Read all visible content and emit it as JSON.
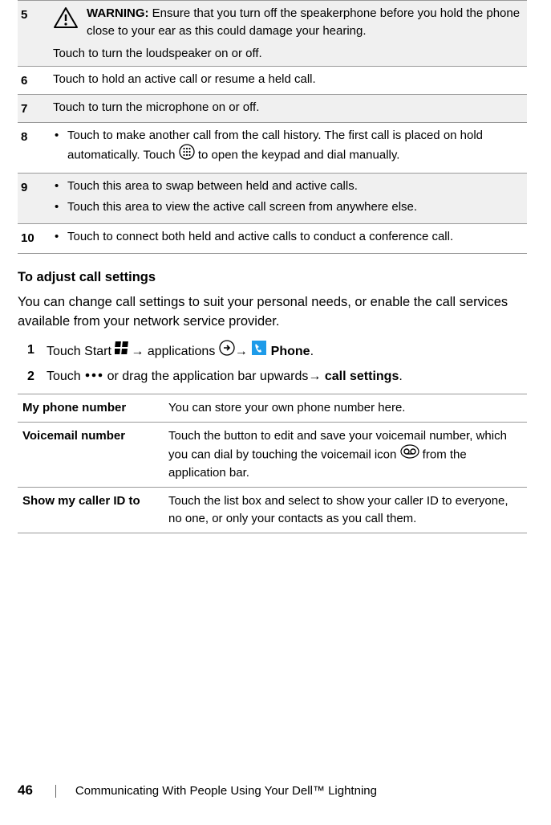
{
  "rows": {
    "r5": {
      "num": "5",
      "warn_label": "WARNING:",
      "warn_text": " Ensure that you turn off the speakerphone before you hold the phone close to your ear as this could damage your hearing.",
      "sub": "Touch to turn the loudspeaker on or off."
    },
    "r6": {
      "num": "6",
      "text": "Touch to hold an active call or resume a held call."
    },
    "r7": {
      "num": "7",
      "text": "Touch to turn the microphone on or off."
    },
    "r8": {
      "num": "8",
      "pre": "Touch to make another call from the call history. The first call is placed on hold automatically. Touch ",
      "post": " to open the keypad and dial manually."
    },
    "r9": {
      "num": "9",
      "b1": "Touch this area to swap between held and active calls.",
      "b2": "Touch this area to view the active call screen from anywhere else."
    },
    "r10": {
      "num": "10",
      "text": "Touch to connect both held and active calls to conduct a conference call."
    }
  },
  "heading": "To adjust call settings",
  "para": "You can change call settings to suit your personal needs, or enable the call services available from your network service provider.",
  "steps": {
    "s1": {
      "num": "1",
      "t1": "Touch Start ",
      "t2": "→ applications ",
      "t3": "→ ",
      "t4": " Phone",
      "t5": "."
    },
    "s2": {
      "num": "2",
      "t1": "Touch ",
      "t2": " or drag the application bar upwards→ ",
      "t3": "call settings",
      "t4": "."
    }
  },
  "settings": {
    "s1": {
      "label": "My phone number",
      "desc": "You can store your own phone number here."
    },
    "s2": {
      "label": "Voicemail number",
      "pre": "Touch the button to edit and save your voicemail number, which you can dial by touching the voicemail icon ",
      "post": " from the application bar."
    },
    "s3": {
      "label": "Show my caller ID to",
      "desc": "Touch the list box and select to show your caller ID to everyone, no one, or only your contacts as you call them."
    }
  },
  "footer": {
    "page": "46",
    "title": "Communicating With People Using Your Dell™ Lightning"
  }
}
